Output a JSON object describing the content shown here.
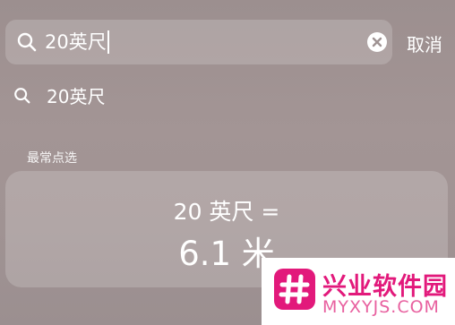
{
  "search": {
    "value": "20英尺",
    "cancel_label": "取消"
  },
  "suggestions": [
    {
      "label": "20英尺"
    }
  ],
  "top_hits": {
    "header": "最常点选",
    "query": "20 英尺 =",
    "answer": "6.1 米"
  },
  "watermark": {
    "name": "兴业软件园",
    "url": "MYXYJS.COM"
  },
  "icons": {
    "search": "search-icon",
    "clear": "clear-circle-icon",
    "logo": "hash-logo-icon"
  },
  "colors": {
    "accent": "#e2197b",
    "text": "#ffffff"
  }
}
